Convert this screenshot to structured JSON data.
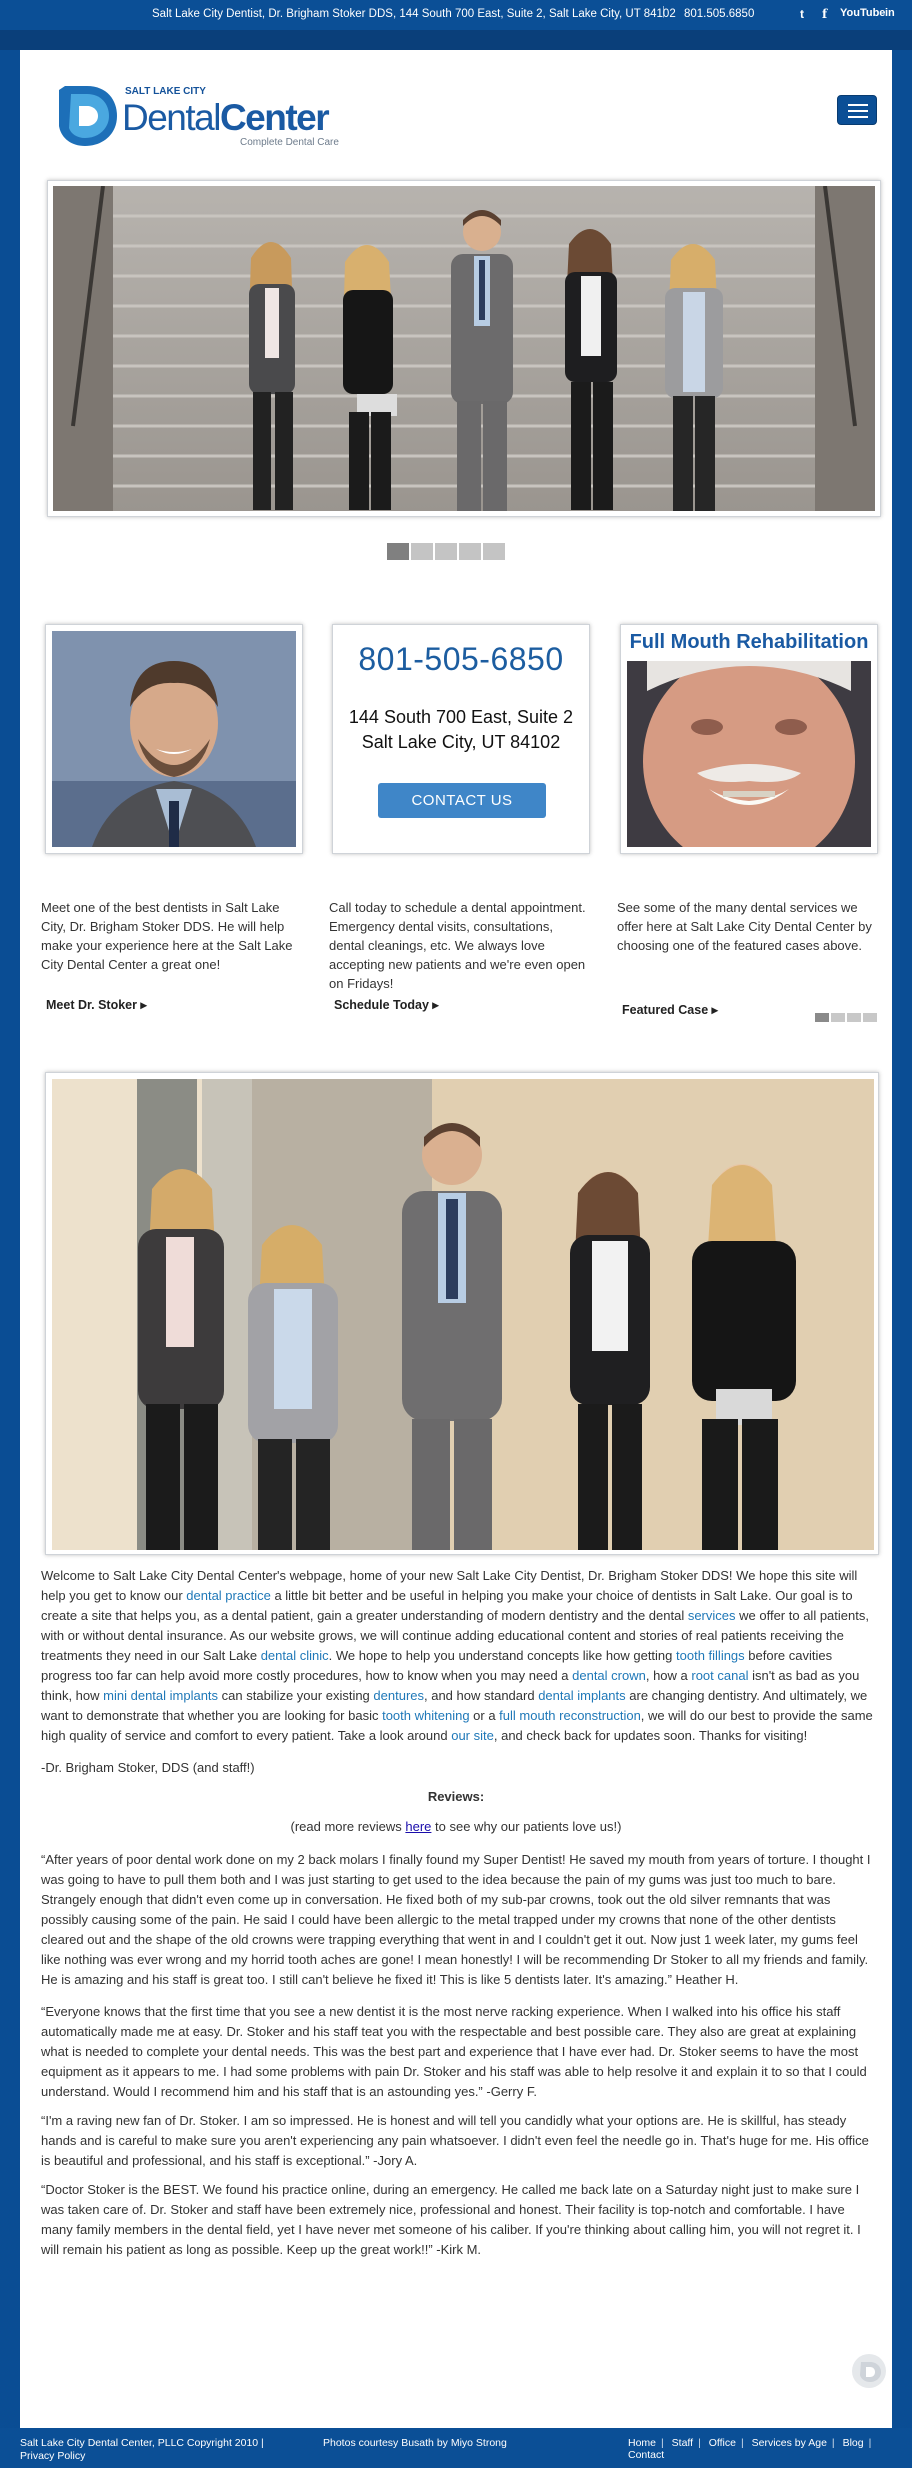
{
  "topbar": {
    "address": "Salt Lake City Dentist, Dr. Brigham Stoker DDS, 144 South 700 East, Suite 2, Salt Lake City, UT 84102",
    "separator": "|",
    "phone": "801.505.6850",
    "social": {
      "twitter": "t",
      "facebook": "f",
      "youtube": "YouTube",
      "linkedin": "in"
    }
  },
  "logo": {
    "small": "SALT LAKE CITY",
    "big_a": "Dental",
    "big_b": "Center",
    "tagline": "Complete Dental Care"
  },
  "slider": {
    "count": 5,
    "active": 0
  },
  "callout": {
    "phone": "801-505-6850",
    "address_line1": "144 South 700 East, Suite 2",
    "address_line2": "Salt Lake City, UT 84102",
    "button": "CONTACT US"
  },
  "featured": {
    "title": "Full Mouth Rehabilitation"
  },
  "columns": [
    {
      "text": "Meet one of the best dentists in Salt Lake City, Dr. Brigham Stoker DDS. He will help make your experience here at the Salt Lake City Dental Center a great one!",
      "link": "Meet Dr. Stoker ▸"
    },
    {
      "text": "Call today to schedule a dental appointment. Emergency dental visits, consultations, dental cleanings, etc. We always love accepting new patients and we're even open on Fridays!",
      "link": "Schedule Today ▸"
    },
    {
      "text": "See some of the many dental services we offer here at Salt Lake City Dental Center by choosing one of the featured cases above.",
      "link": "Featured Case ▸"
    }
  ],
  "intro": {
    "p1": "Welcome to Salt Lake City Dental Center's webpage, home of your new Salt Lake City Dentist, Dr. Brigham Stoker DDS! We hope this site will help you get to know our ",
    "l1": "dental practice",
    "p2": " a little bit better and be useful in helping you make your choice of dentists in Salt Lake. Our goal is to create a site that helps you, as a dental patient, gain a greater understanding of modern dentistry and the dental ",
    "l2": "services",
    "p3": " we offer to all patients, with or without dental insurance. As our website grows, we will continue adding educational content and stories of real patients receiving the treatments they need in our Salt Lake ",
    "l3": "dental clinic",
    "p4": ".  We hope to help you understand concepts like how getting ",
    "l4": "tooth fillings",
    "p5": " before cavities progress too far can help avoid more costly procedures, how to know when you may need a ",
    "l5": "dental crown",
    "p6": ", how a ",
    "l6": "root canal",
    "p7": " isn't as bad as you think, how ",
    "l7": "mini dental implants",
    "p8": " can stabilize your existing ",
    "l8": "dentures",
    "p9": ", and how standard ",
    "l9": "dental implants",
    "p10": " are changing dentistry. And ultimately, we want to demonstrate that whether you are looking for basic ",
    "l10": "tooth whitening",
    "p11": " or a ",
    "l11": "full mouth reconstruction",
    "p12": ", we will do our best to provide the same high quality of service and comfort to every patient. Take a look around ",
    "l12": "our site",
    "p13": ", and check back for updates soon. Thanks for visiting!"
  },
  "signoff": "-Dr. Brigham Stoker, DDS  (and staff!)",
  "reviews": {
    "heading": "Reviews:",
    "sub_before": "(read more reviews ",
    "sub_link": "here",
    "sub_after": " to see why our patients love us!)",
    "items": [
      "“After years of poor dental work done on my 2 back molars I finally found my Super Dentist! He saved my mouth from years of torture. I thought I was going to have to pull them both and I was just starting to get used to the idea because the pain of my gums was just too much to bare. Strangely enough that didn't even come up in conversation. He fixed both of my sub-par crowns, took out the old silver remnants that was possibly causing some of the pain. He said I could have been allergic to the metal trapped under my crowns that none of the other dentists cleared out and the shape of the old crowns were trapping everything that went in and I couldn't get it out. Now just 1 week later, my gums feel like nothing was ever wrong and my horrid tooth aches are gone! I mean honestly! I will be recommending Dr Stoker to all my friends and family. He is amazing and his staff is great too. I still can't believe he fixed it! This is like 5 dentists later. It's amazing.” Heather H.",
      "“Everyone knows that the first time that you see a new dentist it is the most nerve racking experience. When I walked into his office his staff automatically made me at easy. Dr. Stoker and his staff teat you with the respectable and best possible care. They also are great at explaining what is needed to complete your dental needs. This was the best part and experience that I have ever had. Dr. Stoker seems to have the most equipment as it appears to me. I had some problems with pain Dr. Stoker and his staff was able to help resolve it and explain it to so that I could understand. Would I recommend him and his staff that is an astounding yes.” -Gerry F.",
      " “I'm a raving new fan of Dr. Stoker. I am so impressed. He is honest and will tell you candidly what your options are. He is skillful, has steady hands and is careful to make sure you aren't experiencing any pain whatsoever. I didn't even feel the needle go in. That's huge for me. His office is beautiful and professional, and his staff is exceptional.” -Jory A.",
      "“Doctor Stoker is the BEST. We found his practice online, during an emergency. He called me back late on a Saturday night just to make sure I was taken care of. Dr. Stoker and staff have been extremely nice, professional and honest. Their facility is top-notch and comfortable. I have many family members in the dental field, yet I have never met someone of his caliber. If you're thinking about calling him, you will not regret it. I will remain his patient as long as possible. Keep up the great work!!” -Kirk M."
    ]
  },
  "footer": {
    "copyright": "Salt Lake City Dental Center, PLLC Copyright 2010 |",
    "privacy": "Privacy Policy",
    "credit": "Photos courtesy Busath by Miyo Strong",
    "nav": [
      "Home",
      "Staff",
      "Office",
      "Services by Age",
      "Blog",
      "Contact"
    ]
  },
  "colors": {
    "brand_blue": "#0b4f96",
    "link_blue": "#1f78b8",
    "button_blue": "#3f86c8"
  }
}
